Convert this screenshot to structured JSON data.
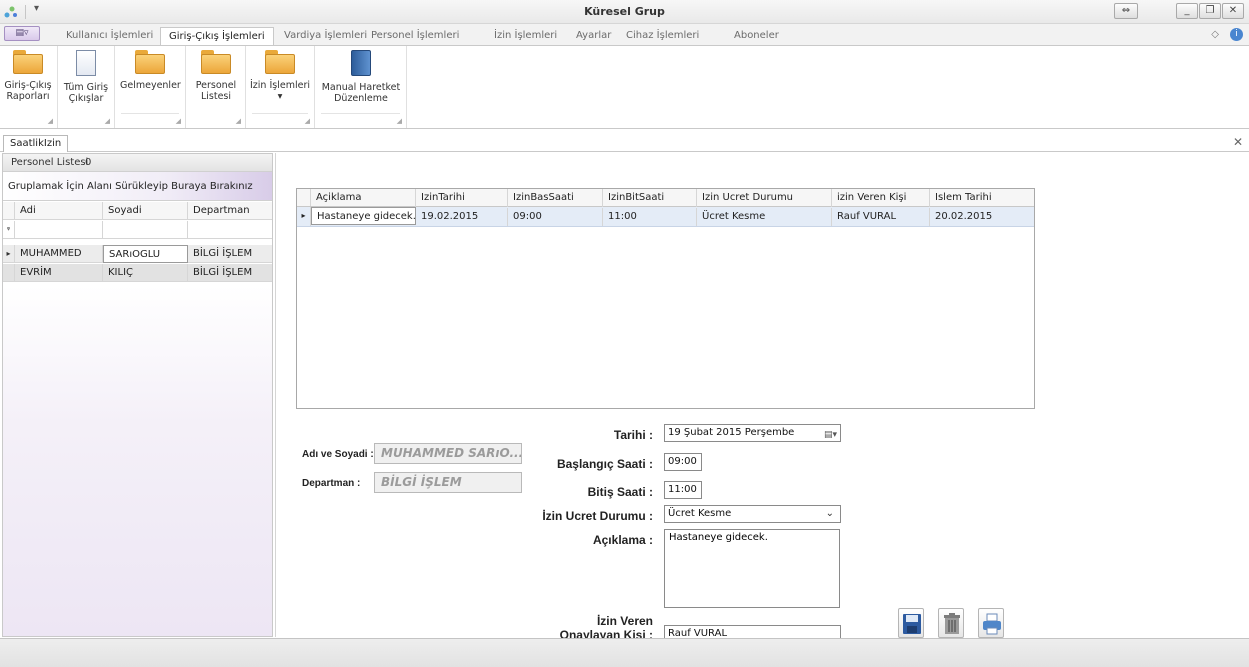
{
  "window": {
    "title": "Küresel Grup",
    "quick_access_arrow": "▾",
    "controls": {
      "restore_alt": "⇔",
      "minimize": "_",
      "maximize": "❐",
      "close": "✕"
    }
  },
  "ribbon": {
    "tabs": [
      {
        "label": "Kullanıcı İşlemleri",
        "active": false
      },
      {
        "label": "Giriş-Çıkış İşlemleri",
        "active": true
      },
      {
        "label": "Vardiya İşlemleri",
        "active": false
      },
      {
        "label": "Personel İşlemleri",
        "active": false
      },
      {
        "label": "İzin İşlemleri",
        "active": false
      },
      {
        "label": "Ayarlar",
        "active": false
      },
      {
        "label": "Cihaz İşlemleri",
        "active": false
      },
      {
        "label": "Aboneler",
        "active": false
      }
    ],
    "app_menu_label": "▤▿",
    "collapse_icon": "◇",
    "help_icon": "i",
    "buttons": [
      {
        "line1": "Giriş-Çıkış",
        "line2": "Raporları",
        "icon": "folder-icon"
      },
      {
        "line1": "Tüm Giriş",
        "line2": "Çıkışlar",
        "icon": "page-icon"
      },
      {
        "line1": "Gelmeyenler",
        "line2": "",
        "icon": "folder-icon"
      },
      {
        "line1": "Personel",
        "line2": "Listesi",
        "icon": "folder-icon"
      },
      {
        "line1": "İzin İşlemleri",
        "line2": "▾",
        "icon": "folder-icon"
      },
      {
        "line1": "Manual Haretket",
        "line2": "Düzenleme",
        "icon": "book-icon"
      }
    ]
  },
  "document": {
    "tab_label": "SaatlikIzin",
    "close_glyph": "✕"
  },
  "personnel_panel": {
    "title": "Personel Listesi",
    "count": "0",
    "group_hint": "Gruplamak İçin Alanı Sürükleyip Buraya Bırakınız",
    "columns": [
      "Adi",
      "Soyadi",
      "Departman"
    ],
    "filter_icon": "ᵠ",
    "rows": [
      {
        "adi": "MUHAMMED",
        "soyadi": "SARıOGLU",
        "departman": "BİLGİ İŞLEM",
        "indicator": "▸"
      },
      {
        "adi": "EVRİM",
        "soyadi": "KILIÇ",
        "departman": "BİLGİ İŞLEM",
        "indicator": ""
      }
    ]
  },
  "leave_grid": {
    "columns": [
      "Açiklama",
      "IzinTarihi",
      "IzinBasSaati",
      "IzinBitSaati",
      "Izin Ucret Durumu",
      "izin Veren Kişi",
      "Islem Tarihi"
    ],
    "rows": [
      {
        "indicator": "▸",
        "aciklama": "Hastaneye gidecek.",
        "izin_tarihi": "19.02.2015",
        "bas_saati": "09:00",
        "bit_saati": "11:00",
        "ucret_durumu": "Ücret Kesme",
        "veren_kisi": "Rauf VURAL",
        "islem_tarihi": "20.02.2015"
      }
    ]
  },
  "form": {
    "adi_soyadi_label": "Adı ve Soyadi :",
    "adi_soyadi_value": "MUHAMMED SARıO...",
    "departman_label": "Departman :",
    "departman_value": "BİLGİ İŞLEM",
    "tarihi_label": "Tarihi :",
    "tarihi_value": "19  Şubat  2015 Perşembe",
    "baslangic_label": "Başlangıç Saati :",
    "baslangic_value": "09:00",
    "bitis_label": "Bitiş Saati :",
    "bitis_value": "11:00",
    "ucret_label": "İzin Ucret Durumu :",
    "ucret_value": "Ücret Kesme",
    "aciklama_label": "Açıklama :",
    "aciklama_value": "Hastaneye gidecek.",
    "veren_label_line1": "İzin Veren",
    "veren_label_line2": "Onaylayan Kişi :",
    "veren_value": "Rauf VURAL",
    "actions": {
      "save_icon": "save-icon",
      "delete_icon": "trash-icon",
      "print_icon": "print-icon"
    }
  },
  "colors": {
    "selected_row": "#e4ecf7",
    "panel_gradient": "#d8cce8",
    "folder": "#f2bd55"
  }
}
